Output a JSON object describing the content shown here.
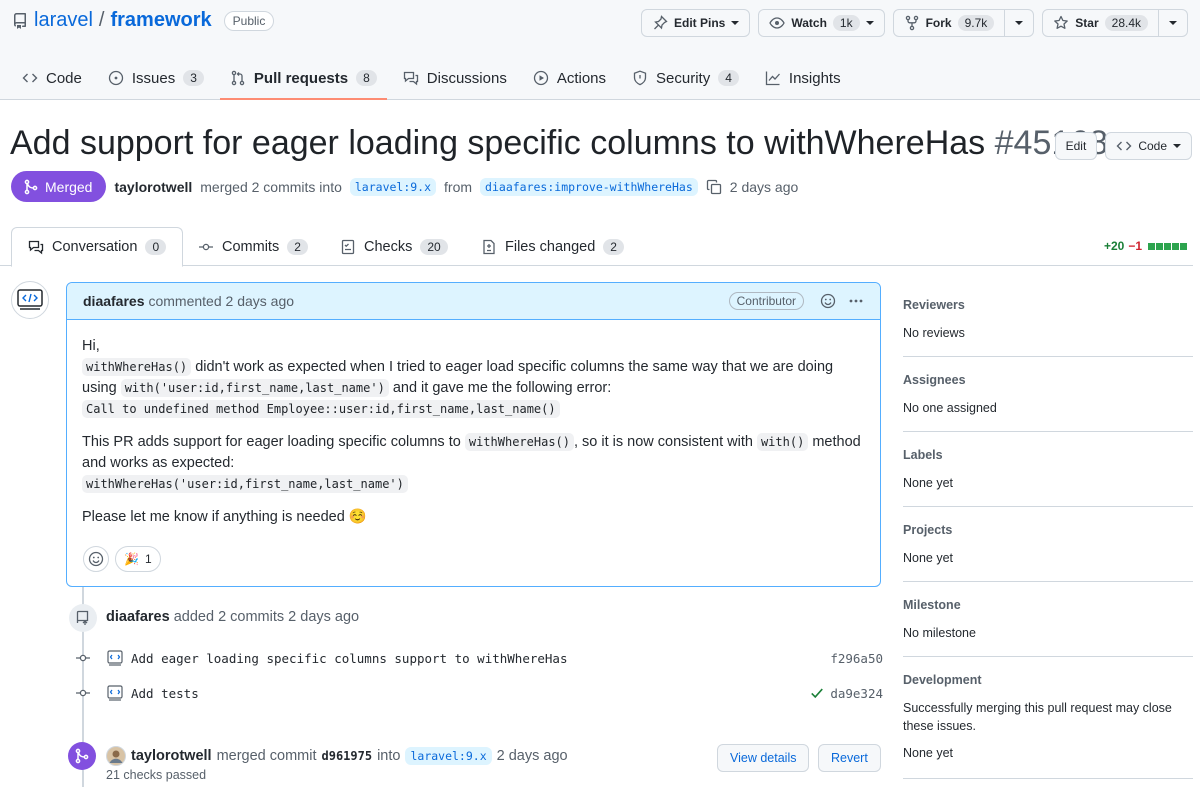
{
  "repo": {
    "owner": "laravel",
    "slash": "/",
    "name": "framework",
    "visibility": "Public"
  },
  "actions": {
    "edit_pins": "Edit Pins",
    "watch": "Watch",
    "watch_count": "1k",
    "fork": "Fork",
    "fork_count": "9.7k",
    "star": "Star",
    "star_count": "28.4k"
  },
  "nav": [
    {
      "label": "Code",
      "count": ""
    },
    {
      "label": "Issues",
      "count": "3"
    },
    {
      "label": "Pull requests",
      "count": "8"
    },
    {
      "label": "Discussions",
      "count": ""
    },
    {
      "label": "Actions",
      "count": ""
    },
    {
      "label": "Security",
      "count": "4"
    },
    {
      "label": "Insights",
      "count": ""
    }
  ],
  "pr": {
    "title": "Add support for eager loading specific columns to withWhereHas",
    "number": "#45168",
    "edit": "Edit",
    "code": "Code",
    "state": "Merged",
    "author": "taylorotwell",
    "merged_text": "merged 2 commits into",
    "base": "laravel:9.x",
    "from": "from",
    "head": "diaafares:improve-withWhereHas",
    "time": "2 days ago"
  },
  "pr_tabs": [
    {
      "label": "Conversation",
      "count": "0"
    },
    {
      "label": "Commits",
      "count": "2"
    },
    {
      "label": "Checks",
      "count": "20"
    },
    {
      "label": "Files changed",
      "count": "2"
    }
  ],
  "diffstat": {
    "add": "+20",
    "del": "−1"
  },
  "comment": {
    "author": "diaafares",
    "action": "commented 2 days ago",
    "role": "Contributor",
    "greeting": "Hi,",
    "code1": "withWhereHas()",
    "text1": "didn't work as expected when I tried to eager load specific columns the same way that we are doing using",
    "code2": "with('user:id,first_name,last_name')",
    "text2": "and it gave me the following error:",
    "code3": "Call to undefined method Employee::user:id,first_name,last_name()",
    "text3": "This PR adds support for eager loading specific columns to",
    "code4": "withWhereHas()",
    "text4": ", so it is now consistent with",
    "code5": "with()",
    "text5": "method and works as expected:",
    "code6": "withWhereHas('user:id,first_name,last_name')",
    "text6": "Please let me know if anything is needed ☺️",
    "reaction_emoji": "🎉",
    "reaction_count": "1"
  },
  "timeline": {
    "commits_author": "diaafares",
    "commits_action": "added 2 commits 2 days ago",
    "commits": [
      {
        "message": "Add eager loading specific columns support to withWhereHas",
        "sha": "f296a50"
      },
      {
        "message": "Add tests",
        "sha": "da9e324"
      }
    ],
    "merge_author": "taylorotwell",
    "merge_text": "merged commit",
    "merge_sha": "d961975",
    "merge_into": "into",
    "merge_base": "laravel:9.x",
    "merge_time": "2 days ago",
    "checks": "21 checks passed",
    "view_details": "View details",
    "revert": "Revert"
  },
  "sidebar": [
    {
      "heading": "Reviewers",
      "value": "No reviews"
    },
    {
      "heading": "Assignees",
      "value": "No one assigned"
    },
    {
      "heading": "Labels",
      "value": "None yet"
    },
    {
      "heading": "Projects",
      "value": "None yet"
    },
    {
      "heading": "Milestone",
      "value": "No milestone"
    }
  ],
  "development": {
    "heading": "Development",
    "text": "Successfully merging this pull request may close these issues.",
    "value": "None yet"
  },
  "colors": {
    "merged": "#8250df",
    "link": "#0969da",
    "add": "#1a7f37",
    "del": "#cf222e"
  }
}
